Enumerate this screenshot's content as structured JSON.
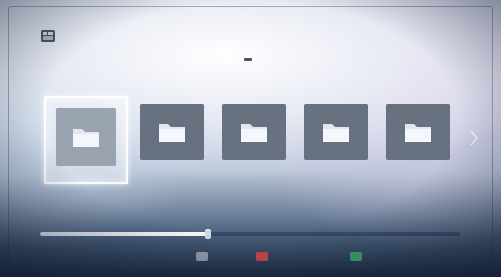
{
  "header": {
    "app_title": "",
    "app_icon": "hand-menu-icon",
    "top_right_text": "",
    "folder_count": ""
  },
  "browser": {
    "selected_index": 0,
    "folders": [
      {
        "label": "",
        "icon": "folder-icon"
      },
      {
        "label": "",
        "icon": "folder-icon"
      },
      {
        "label": "",
        "icon": "folder-icon"
      },
      {
        "label": "",
        "icon": "folder-icon"
      },
      {
        "label": "",
        "icon": "folder-icon"
      }
    ],
    "next_arrow_icon": "chevron-right-icon"
  },
  "progress": {
    "fraction": 0.4,
    "label": ""
  },
  "hints": [
    {
      "label": "",
      "color": "#9aa6b8",
      "icon": "back-key-icon"
    },
    {
      "label": "",
      "color": "#d64a4a",
      "icon": "red-key-icon"
    },
    {
      "label": "",
      "color": "#3fae6a",
      "icon": "green-key-icon"
    }
  ],
  "colors": {
    "tile": "#687180",
    "tile_selected": "#9aa3b0",
    "selection_glow": "#ffffff",
    "folder": "#e2e7ee"
  }
}
